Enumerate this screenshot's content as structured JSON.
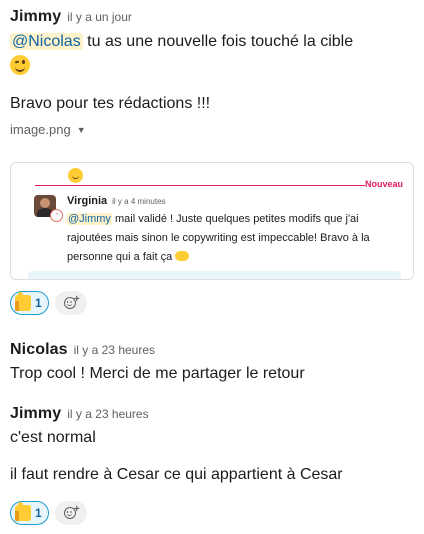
{
  "messages": [
    {
      "author": "Jimmy",
      "time": "il y a un jour",
      "mention": "@Nicolas",
      "text1": "tu as une nouvelle fois touché la cible",
      "emoji1": "wink-emoji",
      "text2": "Bravo pour tes rédactions !!!",
      "file": {
        "name": "image.png",
        "caret_icon": "caret-down-icon"
      },
      "reaction": {
        "emoji": "thumbs-up-emoji",
        "count": "1"
      }
    },
    {
      "author": "Nicolas",
      "time": "il y a 23 heures",
      "text": "Trop cool ! Merci de me partager le retour"
    },
    {
      "author": "Jimmy",
      "time": "il y a 23 heures",
      "text1": "c'est normal",
      "text2": "il faut rendre à Cesar ce qui appartient à Cesar",
      "reaction": {
        "emoji": "thumbs-up-emoji",
        "count": "1"
      }
    }
  ],
  "preview": {
    "new_label": "Nouveau",
    "author": "Virginia",
    "time": "il y a 4 minutes",
    "mention": "@Jimmy",
    "text_a": "mail validé ! Juste quelques petites modifs que j'ai",
    "text_b": "rajoutées mais sinon le copywriting est impeccable! Bravo à la",
    "text_c": "personne qui a fait ça"
  }
}
